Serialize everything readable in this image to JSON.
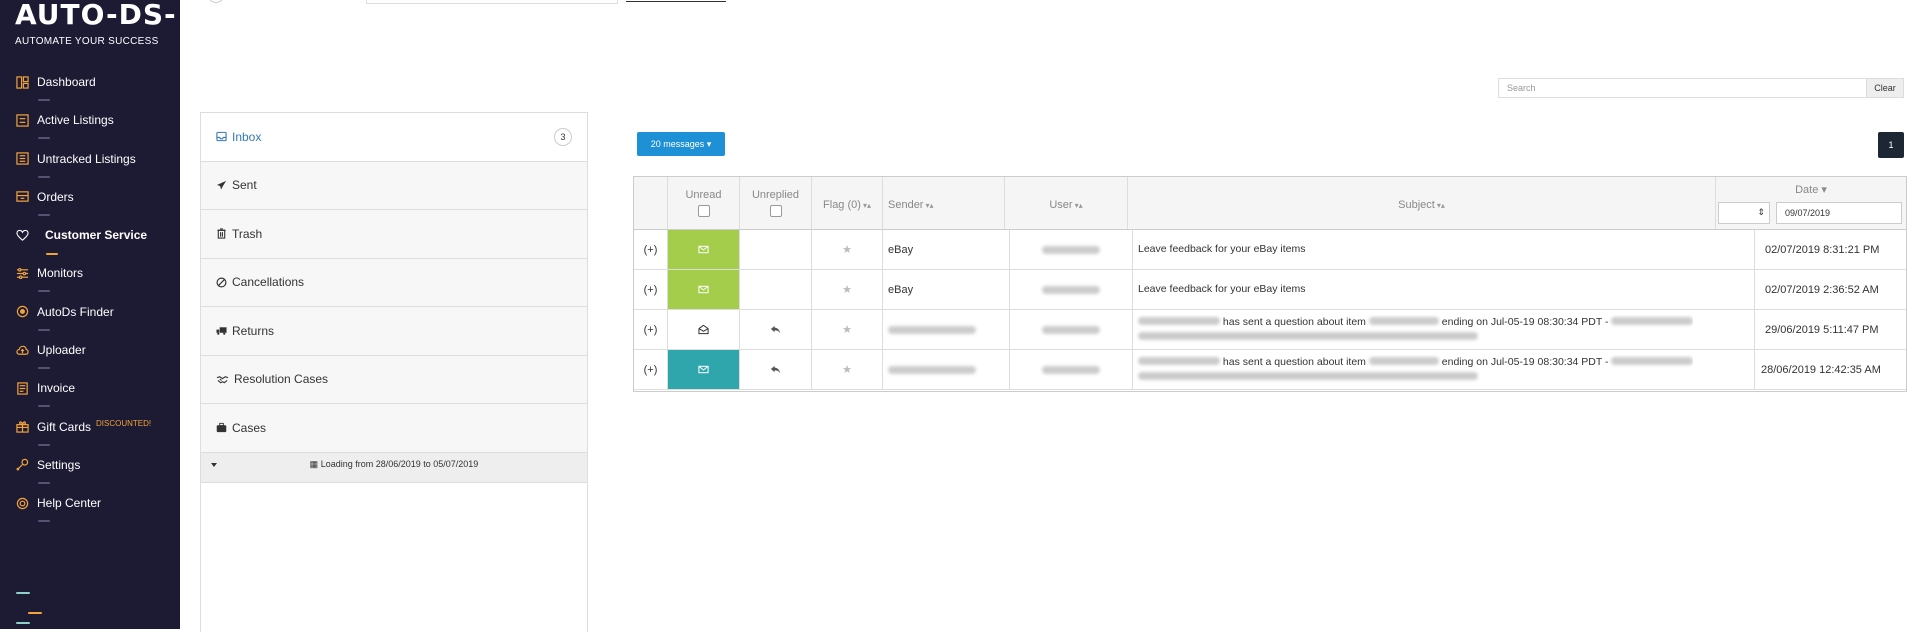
{
  "sidebar": {
    "logo": "AUTO-DS-",
    "tagline": "AUTOMATE YOUR SUCCESS",
    "items": [
      {
        "label": "Dashboard",
        "icon": "dashboard-icon"
      },
      {
        "label": "Active Listings",
        "icon": "listings-icon"
      },
      {
        "label": "Untracked Listings",
        "icon": "untracked-icon"
      },
      {
        "label": "Orders",
        "icon": "orders-icon"
      },
      {
        "label": "Customer Service",
        "icon": "heart-icon",
        "active": true
      },
      {
        "label": "Monitors",
        "icon": "sliders-icon"
      },
      {
        "label": "AutoDs Finder",
        "icon": "finder-icon"
      },
      {
        "label": "Uploader",
        "icon": "cloud-upload-icon"
      },
      {
        "label": "Invoice",
        "icon": "invoice-icon"
      },
      {
        "label": "Gift Cards",
        "icon": "gift-icon",
        "badge": "DISCOUNTED!"
      },
      {
        "label": "Settings",
        "icon": "wrench-icon"
      },
      {
        "label": "Help Center",
        "icon": "lifebuoy-icon"
      }
    ],
    "colors": {
      "bg": "#1d1a33",
      "accent": "#f2a33a",
      "teal": "#8fd1c8"
    }
  },
  "search": {
    "placeholder": "Search",
    "clear_label": "Clear"
  },
  "folders": {
    "items": [
      {
        "label": "Inbox",
        "icon": "inbox-icon",
        "count": "3",
        "active": true
      },
      {
        "label": "Sent",
        "icon": "paper-plane-icon"
      },
      {
        "label": "Trash",
        "icon": "trash-icon"
      },
      {
        "label": "Cancellations",
        "icon": "ban-icon"
      },
      {
        "label": "Returns",
        "icon": "truck-icon"
      },
      {
        "label": "Resolution Cases",
        "icon": "handshake-icon"
      },
      {
        "label": "Cases",
        "icon": "briefcase-icon"
      }
    ],
    "loading_text": "Loading from 28/06/2019 to 05/07/2019"
  },
  "messages_button": "20 messages",
  "pagination": {
    "current": "1"
  },
  "table": {
    "headers": {
      "unread": "Unread",
      "unreplied": "Unreplied",
      "flag": "Flag (0)",
      "sender": "Sender",
      "user": "User",
      "subject": "Subject",
      "date": "Date"
    },
    "date_filter_value": "09/07/2019",
    "rows": [
      {
        "expand": "(+)",
        "status": "unread",
        "replied": false,
        "sender": "eBay",
        "subject": "Leave feedback for your eBay items",
        "date": "02/07/2019 8:31:21 PM"
      },
      {
        "expand": "(+)",
        "status": "unread",
        "replied": false,
        "sender": "eBay",
        "subject": "Leave feedback for your eBay items",
        "date": "02/07/2019 2:36:52 AM"
      },
      {
        "expand": "(+)",
        "status": "read",
        "replied": true,
        "sender": "",
        "subject_part1": "has sent a question about item",
        "subject_part2": "ending on Jul-05-19 08:30:34 PDT -",
        "date": "29/06/2019 5:11:47 PM"
      },
      {
        "expand": "(+)",
        "status": "unread-teal",
        "replied": true,
        "sender": "",
        "subject_part1": "has sent a question about item",
        "subject_part2": "ending on Jul-05-19 08:30:34 PDT -",
        "date": "28/06/2019 12:42:35 AM"
      }
    ],
    "colors": {
      "unread_green": "#a3cd4a",
      "unread_teal": "#2fa6ab"
    }
  }
}
